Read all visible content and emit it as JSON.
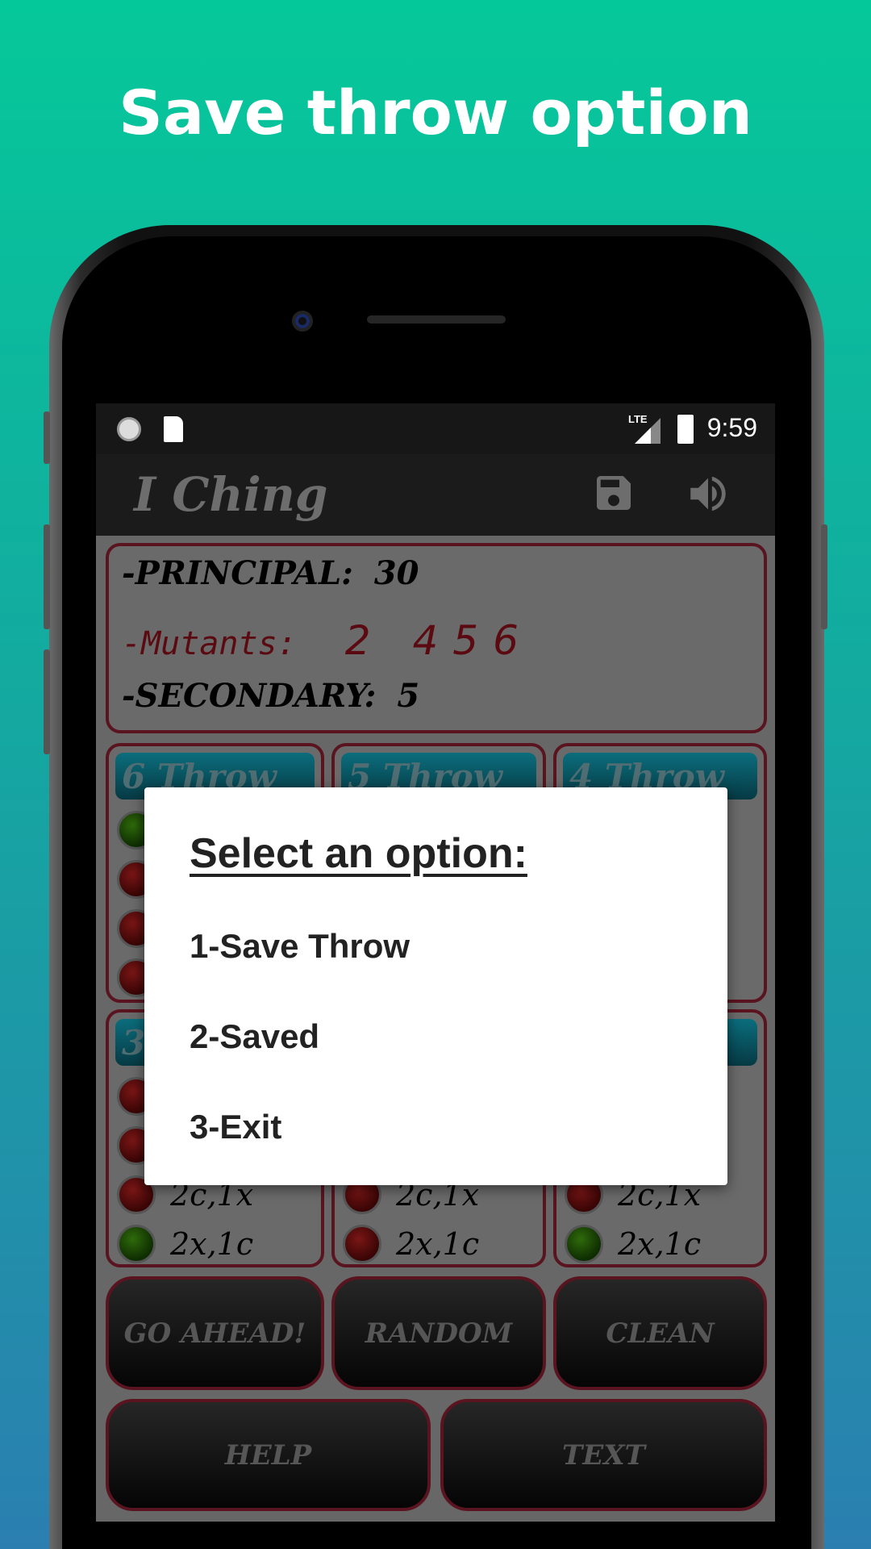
{
  "headline": "Save throw option",
  "status_bar": {
    "time": "9:59",
    "network": "LTE"
  },
  "toolbar": {
    "title": "I Ching",
    "icons": [
      "save-icon",
      "volume-icon"
    ]
  },
  "summary": {
    "principal_label": "-PRINCIPAL:",
    "principal_value": "30",
    "mutants_label": "-Mutants:",
    "mutants_value": "2 456",
    "secondary_label": "-SECONDARY:",
    "secondary_value": "5"
  },
  "throws": [
    {
      "title": "6 Throw",
      "leds": [
        "green",
        "red",
        "red",
        "red"
      ],
      "labels": [
        "",
        "",
        "",
        ""
      ]
    },
    {
      "title": "5 Throw",
      "leds": [],
      "labels": [
        "",
        "",
        "",
        ""
      ]
    },
    {
      "title": "4 Throw",
      "leds": [],
      "labels": [
        "",
        "",
        "",
        ""
      ]
    },
    {
      "title": "3",
      "leds": [
        "red",
        "red",
        "red",
        "green"
      ],
      "labels": [
        "",
        "",
        "2c,1x",
        "2x,1c"
      ]
    },
    {
      "title": "",
      "leds": [
        "red",
        "red",
        "red",
        "red"
      ],
      "labels": [
        "",
        "",
        "2c,1x",
        "2x,1c"
      ]
    },
    {
      "title": "",
      "leds": [
        "red",
        "red",
        "red",
        "green"
      ],
      "labels": [
        "",
        "",
        "2c,1x",
        "2x,1c"
      ]
    }
  ],
  "buttons": {
    "go_ahead": "GO AHEAD!",
    "random": "RANDOM",
    "clean": "CLEAN",
    "help": "HELP",
    "text": "TEXT"
  },
  "dialog": {
    "title": "Select an option:",
    "options": [
      "1-Save Throw",
      "2-Saved",
      "3-Exit"
    ]
  },
  "colors": {
    "background_top": "#05c89a",
    "background_bottom": "#2a7fb0",
    "border": "#5a1420",
    "throw_header": "#0b6d7c"
  }
}
